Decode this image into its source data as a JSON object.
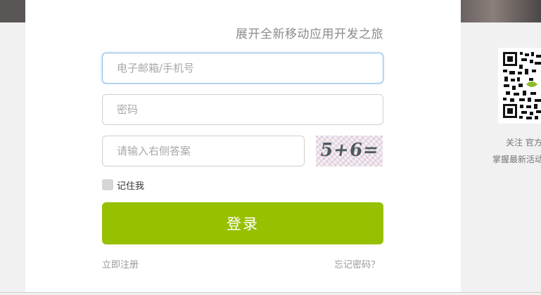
{
  "login": {
    "slogan": "展开全新移动应用开发之旅",
    "email_placeholder": "电子邮箱/手机号",
    "password_placeholder": "密码",
    "captcha_placeholder": "请输入右侧答案",
    "captcha_text": "5+6=",
    "remember_label": "记住我",
    "login_button": "登录",
    "register_link": "立即注册",
    "forgot_link": "忘记密码？"
  },
  "sidebar": {
    "follow_line1": "关注 官方",
    "follow_line2": "掌握最新活动"
  },
  "colors": {
    "accent": "#97c000",
    "focus_border": "#8fbde6",
    "page_bg": "#f1f1f1"
  }
}
